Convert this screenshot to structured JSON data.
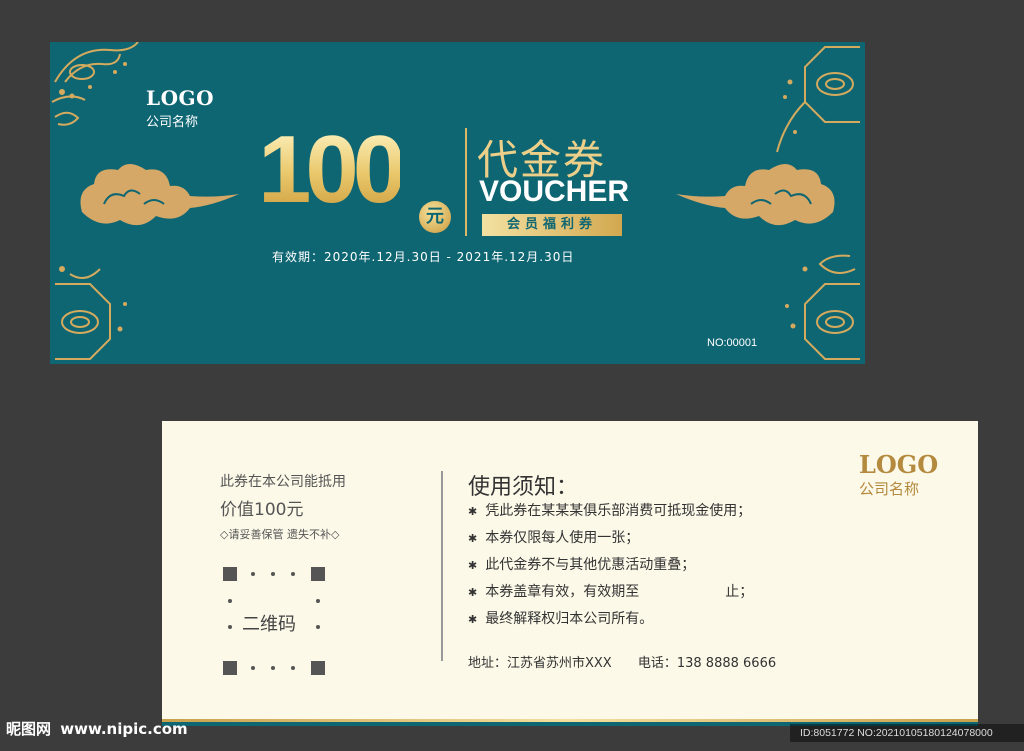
{
  "colors": {
    "background": "#3c3c3c",
    "teal": "#0f6673",
    "gold": "#d8b866",
    "cream": "#fcf9e8"
  },
  "front": {
    "logo": "LOGO",
    "company": "公司名称",
    "amount": "100",
    "unit": "元",
    "title_cn": "代金券",
    "title_en": "VOUCHER",
    "member_label": "会员福利券",
    "validity": "有效期：2020年.12月.30日 - 2021年.12月.30日",
    "serial": "NO:00001"
  },
  "back": {
    "usage_line1": "此券在本公司能抵用",
    "usage_line2": "价值100元",
    "usage_note": "◇请妥善保管 遗失不补◇",
    "qr_label": "二维码",
    "rules_title": "使用须知：",
    "rules": [
      "凭此券在某某某俱乐部消费可抵现金使用；",
      "本券仅限每人使用一张；",
      "此代金券不与其他优惠活动重叠；",
      "本券盖章有效，有效期至",
      "最终解释权归本公司所有。"
    ],
    "rule4_suffix": "止；",
    "address": "地址：江苏省苏州市XXX",
    "phone": "电话：138 8888 6666",
    "logo": "LOGO",
    "company": "公司名称"
  },
  "watermark": {
    "site_name": "昵图网",
    "site_url": "www.nipic.com",
    "image_id": "ID:8051772 NO:20210105180124078000"
  }
}
